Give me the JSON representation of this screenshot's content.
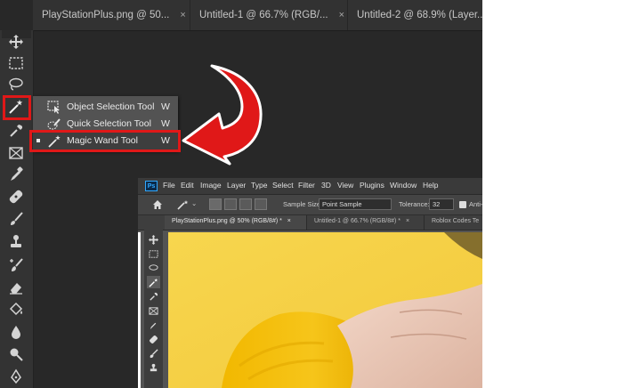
{
  "tabs": [
    {
      "label": "PlayStationPlus.png @ 50...",
      "close": "×"
    },
    {
      "label": "Untitled-1 @ 66.7% (RGB/...",
      "close": "×"
    },
    {
      "label": "Untitled-2 @ 68.9% (Layer...",
      "close": ""
    }
  ],
  "toolbar": {
    "tools": [
      "move-icon",
      "marquee-icon",
      "lasso-icon",
      "magic-wand-icon",
      "eyedropper-icon",
      "frame-icon",
      "brush-icon",
      "healing-icon",
      "paintbrush-icon",
      "stamp-icon",
      "history-brush-icon",
      "eraser-icon",
      "paint-bucket-icon",
      "blur-icon",
      "dodge-icon",
      "pen-icon"
    ]
  },
  "flyout": {
    "items": [
      {
        "label": "Object Selection Tool",
        "key": "W",
        "selected": false
      },
      {
        "label": "Quick Selection Tool",
        "key": "W",
        "selected": false
      },
      {
        "label": "Magic Wand Tool",
        "key": "W",
        "selected": true
      }
    ]
  },
  "inset": {
    "logo": "Ps",
    "menu": [
      "File",
      "Edit",
      "Image",
      "Layer",
      "Type",
      "Select",
      "Filter",
      "3D",
      "View",
      "Plugins",
      "Window",
      "Help"
    ],
    "options": {
      "sample_size_label": "Sample Size:",
      "sample_size_value": "Point Sample",
      "tolerance_label": "Tolerance:",
      "tolerance_value": "32",
      "antialias_label": "Anti-a"
    },
    "tabs": [
      {
        "label": "PlayStationPlus.png @ 50% (RGB/8#) *",
        "close": "×"
      },
      {
        "label": "Untitled-1 @ 66.7% (RGB/8#) *",
        "close": "×"
      },
      {
        "label": "Roblox Codes Te"
      }
    ]
  },
  "colors": {
    "highlight": "#e01818",
    "arrow": "#e01818",
    "canvas_yellow": "#f9d84c"
  }
}
